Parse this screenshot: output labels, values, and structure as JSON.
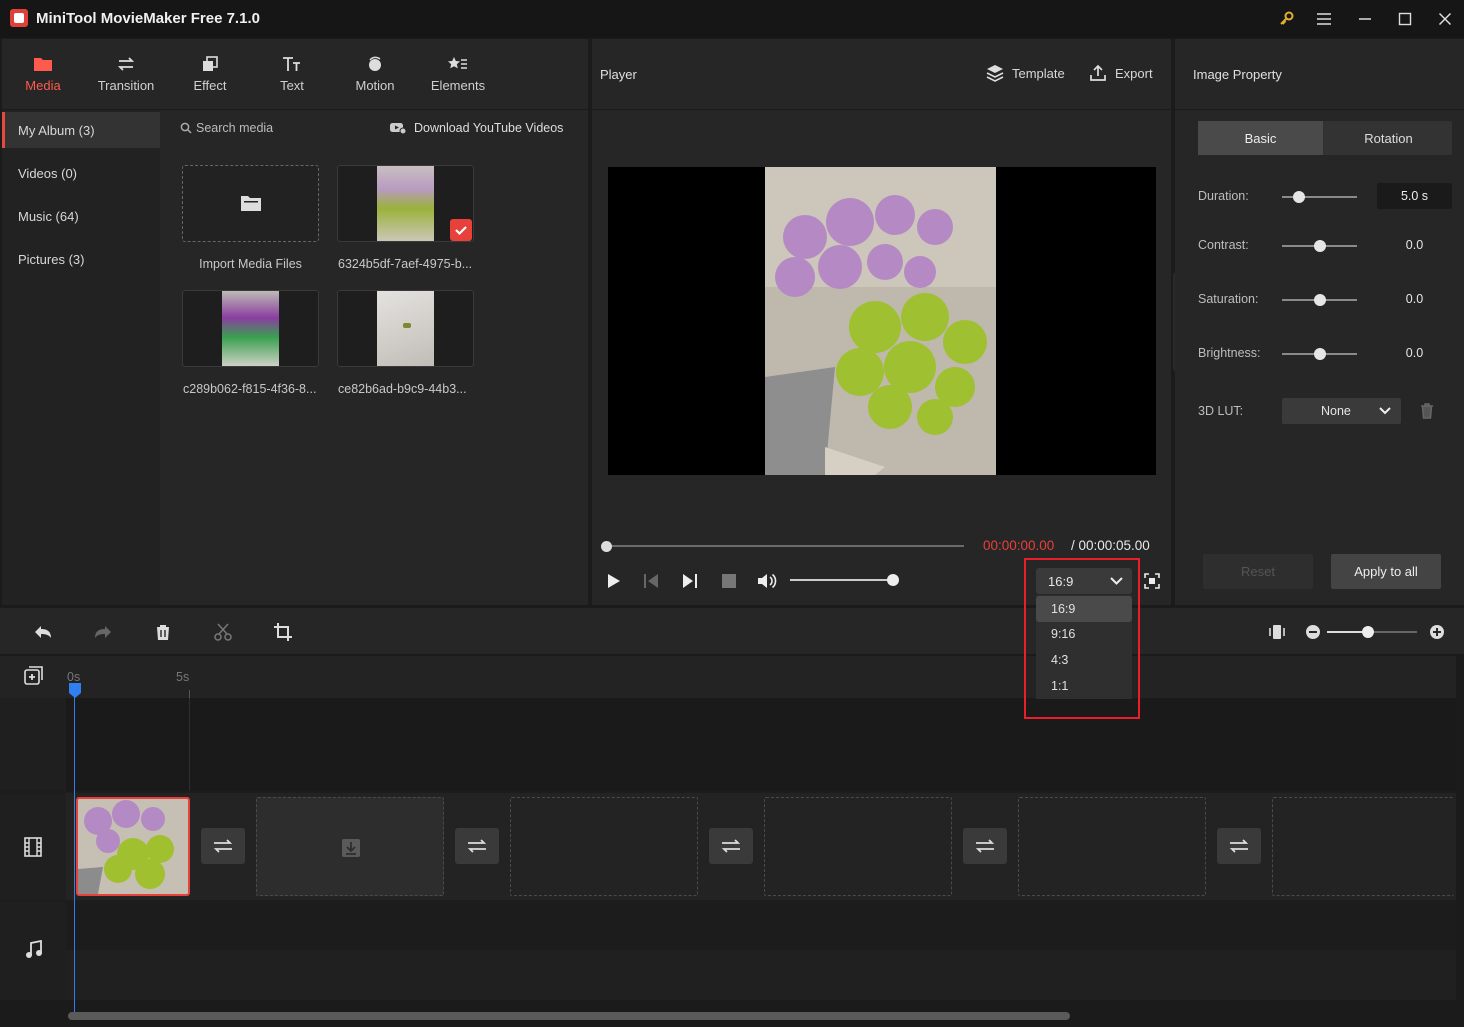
{
  "titlebar": {
    "title": "MiniTool MovieMaker Free 7.1.0"
  },
  "toolbar": {
    "tabs": [
      {
        "label": "Media"
      },
      {
        "label": "Transition"
      },
      {
        "label": "Effect"
      },
      {
        "label": "Text"
      },
      {
        "label": "Motion"
      },
      {
        "label": "Elements"
      }
    ]
  },
  "albums": [
    {
      "label": "My Album (3)"
    },
    {
      "label": "Videos (0)"
    },
    {
      "label": "Music (64)"
    },
    {
      "label": "Pictures (3)"
    }
  ],
  "search": {
    "placeholder": "Search media",
    "youtube": "Download YouTube Videos"
  },
  "media": [
    {
      "label": "Import Media Files"
    },
    {
      "label": "6324b5df-7aef-4975-b..."
    },
    {
      "label": "c289b062-f815-4f36-8..."
    },
    {
      "label": "ce82b6ad-b9c9-44b3..."
    }
  ],
  "player": {
    "title": "Player",
    "template": "Template",
    "export": "Export",
    "current_time": "00:00:00.00",
    "total_time": "/ 00:00:05.00",
    "progress": 0,
    "volume": 1.0
  },
  "property": {
    "title": "Image Property",
    "tabs": [
      {
        "label": "Basic"
      },
      {
        "label": "Rotation"
      }
    ],
    "rows": [
      {
        "label": "Duration:",
        "value": "5.0 s",
        "level": 0.22
      },
      {
        "label": "Contrast:",
        "value": "0.0",
        "level": 0.5
      },
      {
        "label": "Saturation:",
        "value": "0.0",
        "level": 0.5
      },
      {
        "label": "Brightness:",
        "value": "0.0",
        "level": 0.5
      }
    ],
    "lut": {
      "label": "3D LUT:",
      "value": "None"
    },
    "reset": "Reset",
    "apply_all": "Apply to all"
  },
  "aspect": {
    "selected": "16:9",
    "options": [
      {
        "label": "16:9"
      },
      {
        "label": "9:16"
      },
      {
        "label": "4:3"
      },
      {
        "label": "1:1"
      }
    ]
  },
  "timeline": {
    "ruler": [
      {
        "label": "0s"
      },
      {
        "label": "5s"
      }
    ],
    "zoom": 0.45
  },
  "colors": {
    "accent": "#ff5a4e",
    "highlight": "#e8202a",
    "playhead": "#2f7ff0"
  }
}
